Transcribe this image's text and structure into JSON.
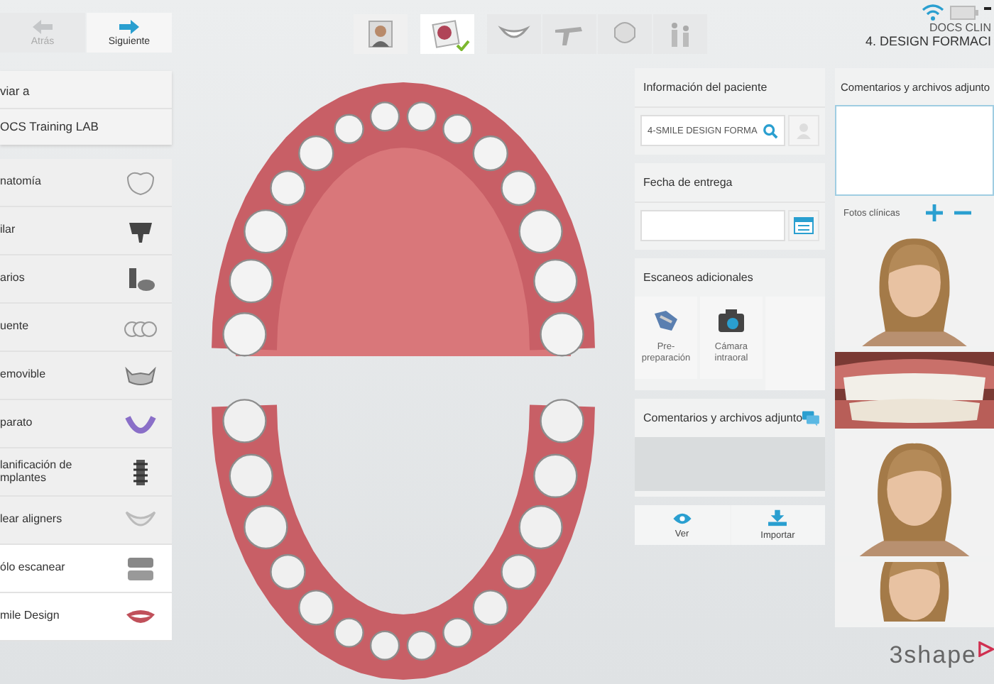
{
  "nav": [
    {
      "label": "Atrás",
      "disabled": true
    },
    {
      "label": "Siguiente",
      "disabled": false
    }
  ],
  "send": {
    "label": "viar a",
    "value": "OCS Training LAB"
  },
  "products": [
    {
      "label": "natomía",
      "selected": false
    },
    {
      "label": "ilar",
      "selected": false
    },
    {
      "label": "arios",
      "selected": false
    },
    {
      "label": "uente",
      "selected": false
    },
    {
      "label": "emovible",
      "selected": false
    },
    {
      "label": "parato",
      "selected": false
    },
    {
      "label": "lanificación de mplantes",
      "selected": false
    },
    {
      "label": "lear aligners",
      "selected": false
    },
    {
      "label": "ólo escanear",
      "selected": true
    },
    {
      "label": "mile Design",
      "selected": true
    }
  ],
  "steps": [
    {
      "completed": false
    },
    {
      "completed": true
    },
    {
      "completed": false
    },
    {
      "completed": false
    },
    {
      "completed": false
    },
    {
      "completed": false
    }
  ],
  "header": {
    "client": "DOCS CLIN",
    "case": "4. DESIGN FORMACI"
  },
  "patient": {
    "title": "Información del paciente",
    "value": "4-SMILE DESIGN FORMA"
  },
  "delivery": {
    "title": "Fecha de entrega"
  },
  "scans": {
    "title": "Escaneos adicionales",
    "items": [
      {
        "lines": [
          "Pre-",
          "preparación"
        ]
      },
      {
        "lines": [
          "Cámara",
          "intraoral"
        ]
      }
    ]
  },
  "comments": {
    "title": "Comentarios y archivos adjunto"
  },
  "actions": [
    "Ver",
    "Importar"
  ],
  "side": {
    "title": "Comentarios y archivos adjunto",
    "photos_label": "Fotos clínicas",
    "photos": [
      {
        "kind": "portrait"
      },
      {
        "kind": "smile"
      },
      {
        "kind": "portrait"
      },
      {
        "kind": "portrait"
      }
    ]
  },
  "brand": "3shape"
}
